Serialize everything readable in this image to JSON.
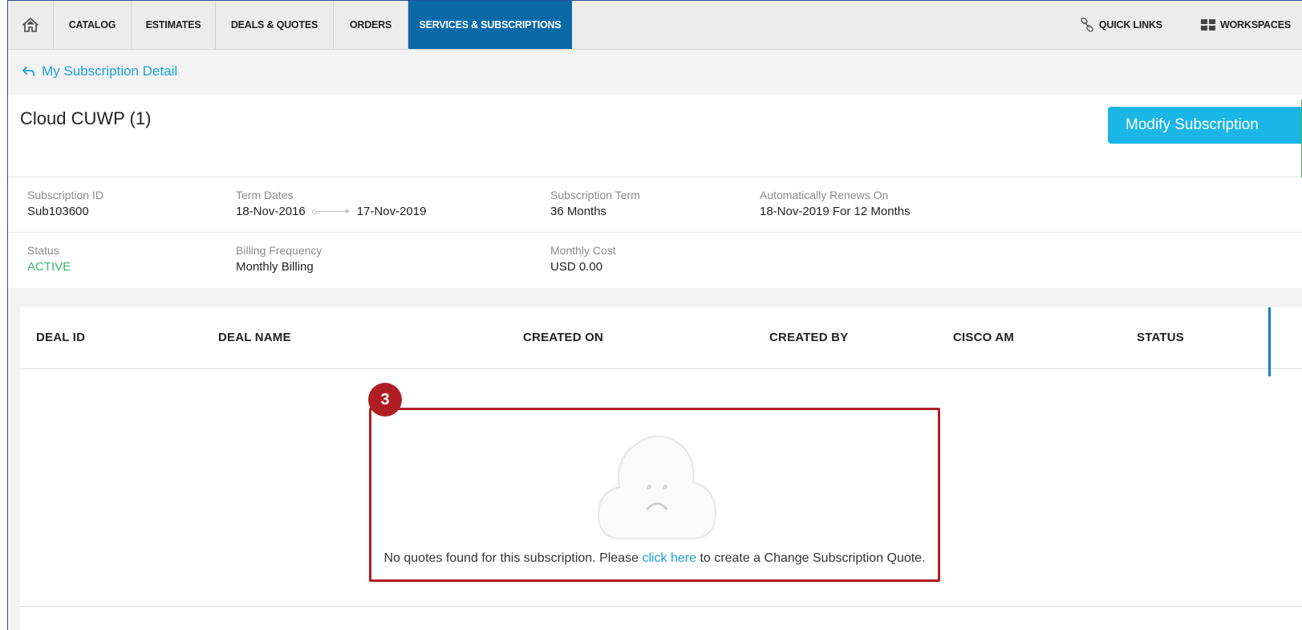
{
  "nav": {
    "home_icon": "home-icon",
    "tabs": [
      {
        "label": "CATALOG",
        "active": false
      },
      {
        "label": "ESTIMATES",
        "active": false
      },
      {
        "label": "DEALS & QUOTES",
        "active": false
      },
      {
        "label": "ORDERS",
        "active": false
      },
      {
        "label": "SERVICES & SUBSCRIPTIONS",
        "active": true
      }
    ],
    "quick_links": "QUICK LINKS",
    "workspaces": "WORKSPACES"
  },
  "breadcrumb": {
    "label": "My Subscription Detail",
    "icon": "back-arrow-icon"
  },
  "header": {
    "title": "Cloud CUWP (1)",
    "modify_button": "Modify Subscription"
  },
  "details": {
    "subscription_id": {
      "label": "Subscription ID",
      "value": "Sub103600"
    },
    "term_dates": {
      "label": "Term Dates",
      "start": "18-Nov-2016",
      "end": "17-Nov-2019"
    },
    "subscription_term": {
      "label": "Subscription Term",
      "value": "36 Months"
    },
    "auto_renew": {
      "label": "Automatically Renews On",
      "value": "18-Nov-2019 For 12 Months"
    },
    "status": {
      "label": "Status",
      "value": "ACTIVE"
    },
    "billing_frequency": {
      "label": "Billing Frequency",
      "value": "Monthly Billing"
    },
    "monthly_cost": {
      "label": "Monthly Cost",
      "value": "USD 0.00"
    }
  },
  "table": {
    "columns": [
      "DEAL ID",
      "DEAL NAME",
      "CREATED ON",
      "CREATED BY",
      "CISCO AM",
      "STATUS"
    ]
  },
  "empty_state": {
    "callout_number": "3",
    "message_before": "No quotes found for this subscription. Please ",
    "link_text": "click here",
    "message_after": " to create a Change Subscription Quote."
  },
  "colors": {
    "active_tab": "#0a6aa8",
    "link": "#1aa0d8",
    "button": "#1ab6e6",
    "status_active": "#3cb371",
    "callout": "#b01e23"
  }
}
